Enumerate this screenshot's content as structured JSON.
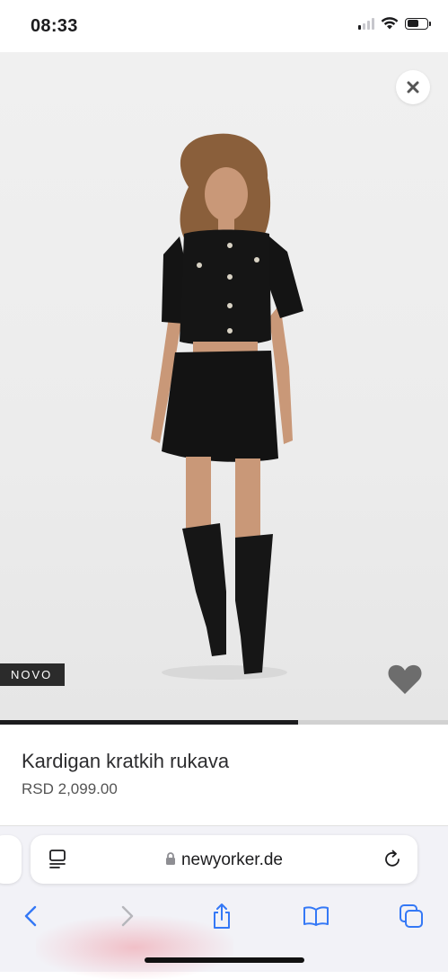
{
  "status_bar": {
    "time": "08:33",
    "signal_bars_active": 1,
    "signal_bars_total": 4,
    "battery_level_percent": 60
  },
  "product": {
    "badge": "NOVO",
    "name": "Kardigan kratkih rukava",
    "price": "RSD 2,099.00",
    "gallery_progress_fraction": 0.665,
    "icons": {
      "close": "close-icon",
      "favorite": "heart-icon"
    }
  },
  "browser": {
    "url": "newyorker.de",
    "icons": {
      "reader": "page-menu-icon",
      "lock": "lock-icon",
      "reload": "reload-icon",
      "back": "back-chevron-icon",
      "forward": "forward-chevron-icon",
      "share": "share-icon",
      "bookmarks": "book-icon",
      "tabs": "tabs-icon"
    },
    "colors": {
      "accent": "#3478f6",
      "disabled": "#b6b6bb"
    }
  }
}
